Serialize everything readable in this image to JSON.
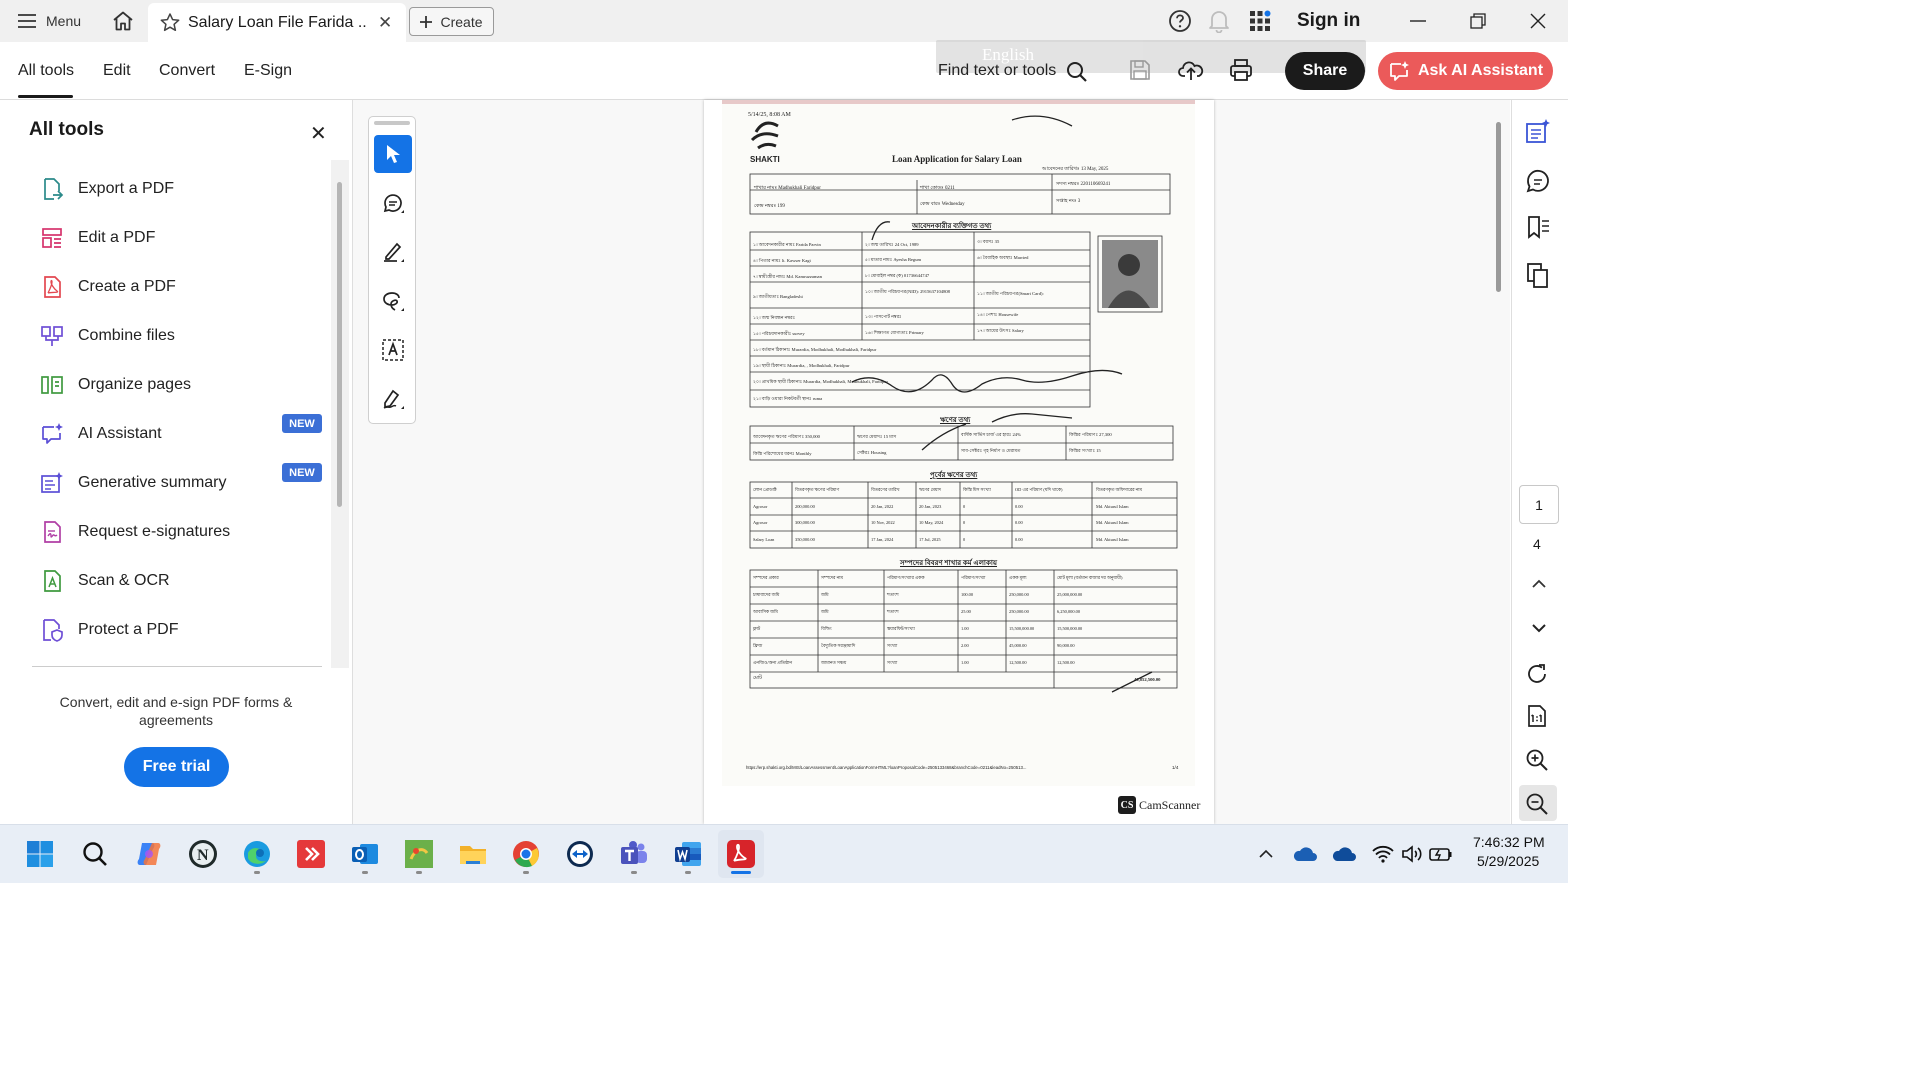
{
  "titlebar": {
    "menu_label": "Menu",
    "tab_title": "Salary Loan File Farida ...",
    "create_label": "Create",
    "sign_in": "Sign in"
  },
  "toolbar": {
    "tabs": [
      "All tools",
      "Edit",
      "Convert",
      "E-Sign"
    ],
    "find_label": "Find text or tools",
    "share_label": "Share",
    "ai_label": "Ask AI Assistant",
    "language_overlay": "English"
  },
  "left_panel": {
    "title": "All tools",
    "tools": [
      {
        "label": "Export a PDF",
        "icon": "export-pdf-icon",
        "color": "#2b8a8a"
      },
      {
        "label": "Edit a PDF",
        "icon": "edit-pdf-icon",
        "color": "#d6336c"
      },
      {
        "label": "Create a PDF",
        "icon": "create-pdf-icon",
        "color": "#e34850"
      },
      {
        "label": "Combine files",
        "icon": "combine-files-icon",
        "color": "#6e4fd6"
      },
      {
        "label": "Organize pages",
        "icon": "organize-pages-icon",
        "color": "#3f9a3f"
      },
      {
        "label": "AI Assistant",
        "icon": "ai-assistant-icon",
        "color": "#5b4fd6",
        "badge": "NEW"
      },
      {
        "label": "Generative summary",
        "icon": "generative-summary-icon",
        "color": "#5b4fd6",
        "badge": "NEW"
      },
      {
        "label": "Request e-signatures",
        "icon": "request-esign-icon",
        "color": "#b03fa5"
      },
      {
        "label": "Scan & OCR",
        "icon": "scan-ocr-icon",
        "color": "#3f9a3f"
      },
      {
        "label": "Protect a PDF",
        "icon": "protect-pdf-icon",
        "color": "#6e4fd6"
      }
    ],
    "promo": "Convert, edit and e-sign PDF forms & agreements",
    "trial_label": "Free trial"
  },
  "document": {
    "heading": "Loan Application for Salary Loan",
    "org": "SHAKTI",
    "timestamp": "5/14/25, 8:08 AM",
    "application_date": "আবেদনের তারিখঃ 13 May, 2025",
    "branch": "শাখার নামঃ Madhukhali Faridpur",
    "branch_code": "শাখা কোডঃ 0211",
    "member_no": "সদস্য নম্বরঃ 220110669241",
    "center_no": "কেন্দ্র নম্বরঃ 199",
    "center_day": "কেন্দ্র বারঃ Wednesday",
    "week_no": "সপ্তাহ নংঃ 3",
    "section_personal": "আবেদনকারীর ব্যক্তিগত তথ্য",
    "rows_personal": [
      "১। আবেদনকারীর নামঃ Farida Parvin",
      "২। জন্ম তারিখঃ 24 Oct, 1989",
      "৩। বয়সঃ 35",
      "৪। পিতার নামঃ lt. Kawser Kagi",
      "৫। মাতার নামঃ Ayesha Begum",
      "৬। বৈবাহিক অবস্থাঃ Married",
      "৭। স্বামী/স্ত্রীর নামঃ Md. Kamruzzaman",
      "৮। মোবাইল নম্বর (ক) 01736644747",
      "৯। জাতীয়তাঃ Bangladeshi",
      "১০। জাতীয় পরিচয়পত্র(NID): 2915637104808",
      "১১। জাতীয় পরিচয়পত্র(Smart Card):",
      "১২। জন্ম নিবন্ধন নম্বরঃ",
      "১৩। পাসপোর্ট নম্বরঃ",
      "১৪। পেশাঃ Housewife",
      "১৫। পরিচয়দানকারীঃ survey",
      "১৬। শিক্ষাগত যোগ্যতাঃ Primary",
      "১৭। আয়ের উৎসঃ Salary",
      "১৮। বর্তমান ঠিকানাঃ Murardia, Modhukhali, Modhukhali, Faridpur",
      "১৯। স্থায়ী ঠিকানাঃ Murardia, , Modhukhali, Faridpur",
      "২০। প্রাথমিক স্থায়ী ঠিকানাঃ Murardia, Modhukhali, Modhukhali, Faridpur",
      "২১। বাড়ি ওয়ারা নিকটবর্তী স্থানঃ ruma"
    ],
    "section_loan": "ঋণের তথ্য",
    "rows_loan": [
      "আবেদনকৃত ঋণের পরিমাণঃ 350,000",
      "ঋণের মেয়াদঃ 15 মাস",
      "বার্ষিক সার্ভিস চার্জ এর হারঃ 24%",
      "কিস্তির পরিমাণঃ 27,300",
      "কিস্তি পরিশোধের ধরনঃ Monthly",
      "সেক্টরঃ Housing",
      "সাব-সেক্টরঃ গৃহ নির্মাণ ও মেরামত",
      "কিস্তির সংখ্যাঃ 15"
    ],
    "section_prev": "পূর্বের ঋণের তথ্য",
    "prev_headers": [
      "লোন প্রোডাক্ট",
      "বিতরণকৃত ঋণের পরিমাণ",
      "বিতরণের তারিখ",
      "ঋণের মেয়াদ",
      "কিস্তি মিস সংখ্যা",
      "OD এর পরিমাণ (যদি থাকে)",
      "বিতরণকৃত অফিসারের নাম"
    ],
    "prev_rows": [
      [
        "Agrosor",
        "200,000.00",
        "20 Jan, 2022",
        "20 Jan, 2023",
        "0",
        "0.00",
        "Md. Akturul Islam"
      ],
      [
        "Agrosor",
        "300,000.00",
        "10 Nov, 2022",
        "10 May, 2024",
        "0",
        "0.00",
        "Md. Akturul Islam"
      ],
      [
        "Salary Loan",
        "350,000.00",
        "17 Jan, 2024",
        "17 Jul, 2025",
        "0",
        "0.00",
        "Md. Akturul Islam"
      ]
    ],
    "section_assets": "সম্পদের বিবরণ শাখার কর্ম এলাকায়",
    "asset_headers": [
      "সম্পদের প্রকার",
      "সম্পদের নাম",
      "পরিমাণ/সংখ্যার একক",
      "পরিমাণ/সংখ্যা",
      "একক মূল্য",
      "মোট মূল্য (বর্তমান বাজার দর অনুযায়ী)"
    ],
    "asset_rows": [
      [
        "চাষাবাদের জমি",
        "জমি",
        "শতাংশ",
        "100.00",
        "250,000.00",
        "25,000,000.00"
      ],
      [
        "আবাসিক জমি",
        "জমি",
        "শতাংশ",
        "25.00",
        "250,000.00",
        "6,250,000.00"
      ],
      [
        "ফ্লাট",
        "বিল্ডিং",
        "স্কয়ারফিট/সংখ্যা",
        "1.00",
        "15,500,000.00",
        "15,500,000.00"
      ],
      [
        "ফ্রিজ",
        "বৈদ্যুতিক সরঞ্জামাদি",
        "সংখ্যা",
        "2.00",
        "45,000.00",
        "90,000.00"
      ],
      [
        "এনজিও/অন্য প্রতিষ্ঠান",
        "জামানত সঞ্চয়",
        "সংখ্যা",
        "1.00",
        "12,500.00",
        "12,500.00"
      ]
    ],
    "asset_total_label": "মোট",
    "asset_total": "46,852,500.00",
    "footer_url": "https://erp.shakti.org.bd/MIS/LoanAssessment/LoanApplicationFormHTML?loanProposalCode=2505133468&branchCode=0211&leadNo=250513...",
    "footer_page": "1/4",
    "camscanner": "CamScanner"
  },
  "navigation": {
    "current_page": "1",
    "total_pages": "4"
  },
  "taskbar": {
    "time": "7:46:32 PM",
    "date": "5/29/2025"
  },
  "colors": {
    "accent_blue": "#1473e6",
    "ai_red": "#eb5a5a",
    "share_black": "#1b1b1b",
    "badge_blue": "#3b6fd6"
  }
}
